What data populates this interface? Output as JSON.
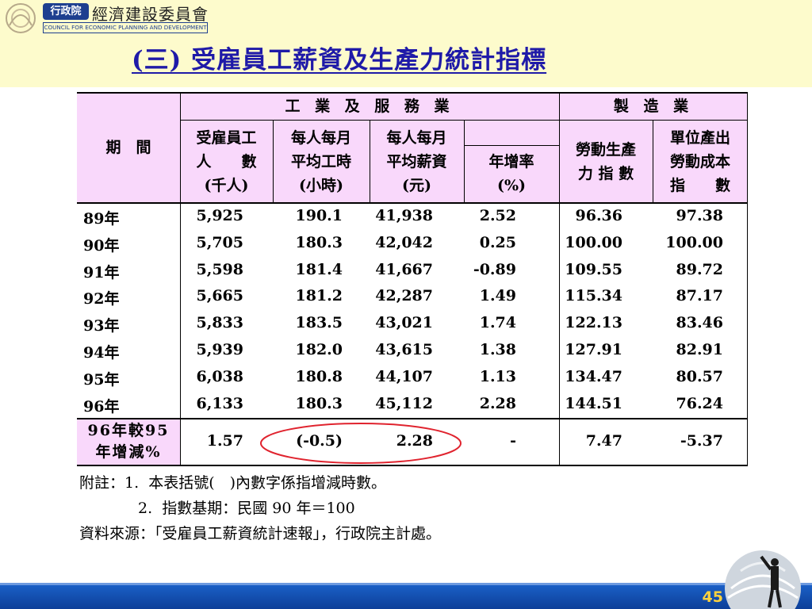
{
  "header": {
    "logo_badge": "行政院",
    "logo_name": "經濟建設委員會",
    "logo_en": "COUNCIL FOR ECONOMIC PLANNING AND DEVELOPMENT",
    "title": "(三) 受雇員工薪資及生產力統計指標"
  },
  "table": {
    "period_label": "期　間",
    "group_industry": "工 業 及 服 務 業",
    "group_manufacturing": "製 造 業",
    "col_employees": [
      "受雇員工",
      "人　　數",
      "(千人)"
    ],
    "col_hours": [
      "每人每月",
      "平均工時",
      "(小時)"
    ],
    "col_wage": [
      "每人每月",
      "平均薪資",
      "(元)"
    ],
    "col_growth": [
      "年增率",
      "(%)"
    ],
    "col_productivity": [
      "勞動生產",
      "力 指 數"
    ],
    "col_unit_cost": [
      "單位產出",
      "勞動成本",
      "指　　數"
    ],
    "rows": [
      {
        "year": "89年",
        "employees": "5,925",
        "hours": "190.1",
        "wage": "41,938",
        "growth": "2.52",
        "productivity": "96.36",
        "unit_cost": "97.38"
      },
      {
        "year": "90年",
        "employees": "5,705",
        "hours": "180.3",
        "wage": "42,042",
        "growth": "0.25",
        "productivity": "100.00",
        "unit_cost": "100.00"
      },
      {
        "year": "91年",
        "employees": "5,598",
        "hours": "181.4",
        "wage": "41,667",
        "growth": "-0.89",
        "productivity": "109.55",
        "unit_cost": "89.72"
      },
      {
        "year": "92年",
        "employees": "5,665",
        "hours": "181.2",
        "wage": "42,287",
        "growth": "1.49",
        "productivity": "115.34",
        "unit_cost": "87.17"
      },
      {
        "year": "93年",
        "employees": "5,833",
        "hours": "183.5",
        "wage": "43,021",
        "growth": "1.74",
        "productivity": "122.13",
        "unit_cost": "83.46"
      },
      {
        "year": "94年",
        "employees": "5,939",
        "hours": "182.0",
        "wage": "43,615",
        "growth": "1.38",
        "productivity": "127.91",
        "unit_cost": "82.91"
      },
      {
        "year": "95年",
        "employees": "6,038",
        "hours": "180.8",
        "wage": "44,107",
        "growth": "1.13",
        "productivity": "134.47",
        "unit_cost": "80.57"
      },
      {
        "year": "96年",
        "employees": "6,133",
        "hours": "180.3",
        "wage": "45,112",
        "growth": "2.28",
        "productivity": "144.51",
        "unit_cost": "76.24"
      }
    ],
    "change_label": [
      "96年較95",
      "年增減%"
    ],
    "change": {
      "employees": "1.57",
      "hours": "(-0.5)",
      "wage": "2.28",
      "growth": "-",
      "productivity": "7.47",
      "unit_cost": "-5.37"
    }
  },
  "notes": {
    "line1": "附註：1.  本表括號(　)內數字係指增減時數。",
    "line2": "2.  指數基期：民國 90 年＝100",
    "line3": "資料來源：「受雇員工薪資統計速報」，行政院主計處。"
  },
  "footer": {
    "page": "45"
  },
  "colors": {
    "title": "#1f1aa8",
    "header_bg": "#f9d8fb",
    "band_bg": "#fdfbcc",
    "footer_bar": "#1a5fc6",
    "circle": "#e0232e",
    "page_num": "#ffd23e"
  }
}
